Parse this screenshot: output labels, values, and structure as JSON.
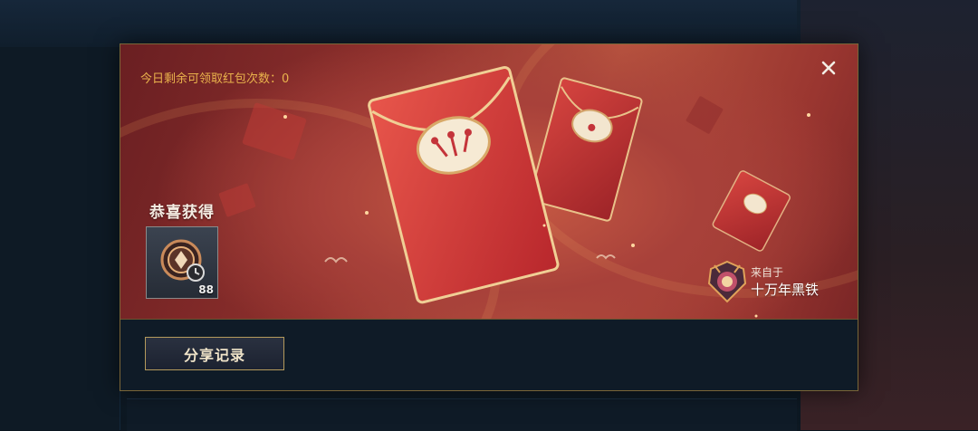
{
  "background": {
    "tabs": [
      "",
      "",
      "",
      "",
      "",
      ""
    ],
    "rail_items": [
      "",
      "",
      "",
      ""
    ]
  },
  "dialog": {
    "remaining_text": "今日剩余可领取红包次数：0",
    "congrats_label": "恭喜获得",
    "reward": {
      "icon": "coin-clock-icon",
      "count": "88"
    },
    "sender": {
      "from_label": "来自于",
      "name": "十万年黑铁",
      "avatar": "rank-emblem-icon"
    },
    "share_button_label": "分享记录",
    "close_icon": "close-icon"
  },
  "colors": {
    "accent_gold": "#e9b24c",
    "envelope_red": "#d8403a",
    "dialog_border": "#7a6638"
  }
}
